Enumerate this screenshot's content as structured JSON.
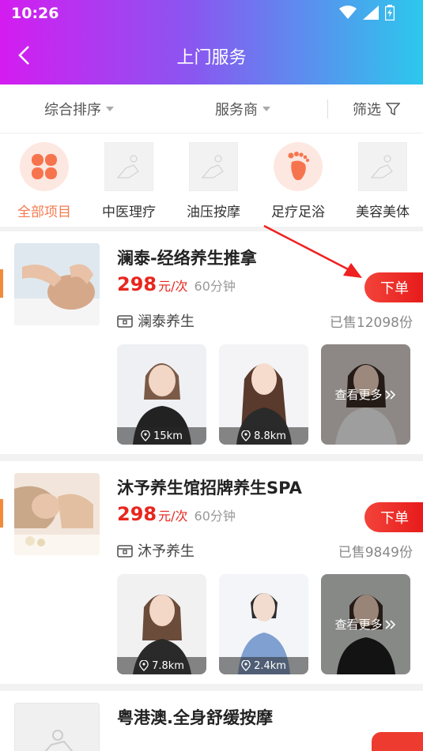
{
  "status": {
    "time": "10:26"
  },
  "header": {
    "title": "上门服务"
  },
  "sortbar": {
    "sort": "综合排序",
    "provider": "服务商",
    "filter": "筛选"
  },
  "categories": [
    {
      "label": "全部项目",
      "icon": "clover-icon",
      "active": true
    },
    {
      "label": "中医理疗",
      "icon": "placeholder-image-icon",
      "active": false
    },
    {
      "label": "油压按摩",
      "icon": "placeholder-image-icon",
      "active": false
    },
    {
      "label": "足疗足浴",
      "icon": "footprint-icon",
      "active": false
    },
    {
      "label": "美容美体",
      "icon": "placeholder-image-icon",
      "active": false
    }
  ],
  "services": [
    {
      "title": "澜泰-经络养生推拿",
      "price": "298",
      "unit": "元/次",
      "duration": "60分钟",
      "order_label": "下单",
      "shop": "澜泰养生",
      "sold": "已售12098份",
      "techs": [
        {
          "distance": "15km"
        },
        {
          "distance": "8.8km"
        }
      ],
      "more_label": "查看更多"
    },
    {
      "title": "沐予养生馆招牌养生SPA",
      "price": "298",
      "unit": "元/次",
      "duration": "60分钟",
      "order_label": "下单",
      "shop": "沐予养生",
      "sold": "已售9849份",
      "techs": [
        {
          "distance": "7.8km"
        },
        {
          "distance": "2.4km"
        }
      ],
      "more_label": "查看更多"
    },
    {
      "title": "粤港澳.全身舒缓按摩"
    }
  ],
  "colors": {
    "accent": "#e8261d",
    "active_category": "#f47a50"
  }
}
